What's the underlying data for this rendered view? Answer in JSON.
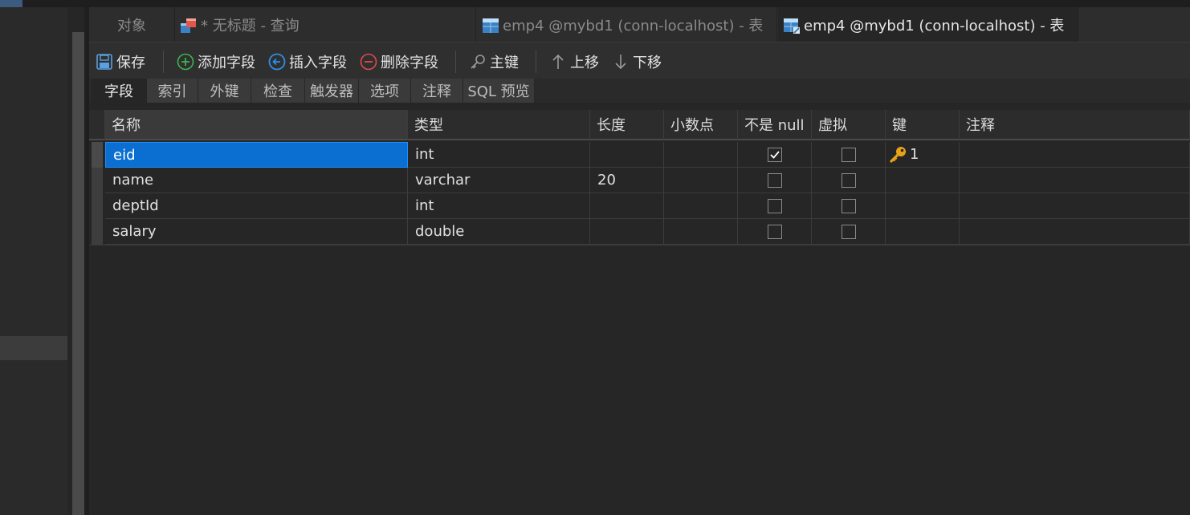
{
  "tabs": [
    {
      "label": "对象",
      "active": false
    },
    {
      "label": "* 无标题 - 查询",
      "active": false,
      "icon": "query-icon"
    },
    {
      "label": "emp4 @mybd1 (conn-localhost) - 表",
      "active": false,
      "icon": "table-icon"
    },
    {
      "label": "emp4 @mybd1 (conn-localhost) - 表",
      "active": true,
      "icon": "table-design-icon"
    }
  ],
  "toolbar": {
    "save": "保存",
    "add_field": "添加字段",
    "insert_field": "插入字段",
    "delete_field": "删除字段",
    "primary_key": "主键",
    "move_up": "上移",
    "move_down": "下移"
  },
  "subtabs": [
    "字段",
    "索引",
    "外键",
    "检查",
    "触发器",
    "选项",
    "注释",
    "SQL 预览"
  ],
  "columns": [
    "名称",
    "类型",
    "长度",
    "小数点",
    "不是 null",
    "虚拟",
    "键",
    "注释"
  ],
  "rows": [
    {
      "name": "eid",
      "type": "int",
      "length": "",
      "decimals": "",
      "not_null": true,
      "virtual": false,
      "key": "1",
      "comment": ""
    },
    {
      "name": "name",
      "type": "varchar",
      "length": "20",
      "decimals": "",
      "not_null": false,
      "virtual": false,
      "key": "",
      "comment": ""
    },
    {
      "name": "deptId",
      "type": "int",
      "length": "",
      "decimals": "",
      "not_null": false,
      "virtual": false,
      "key": "",
      "comment": ""
    },
    {
      "name": "salary",
      "type": "double",
      "length": "",
      "decimals": "",
      "not_null": false,
      "virtual": false,
      "key": "",
      "comment": ""
    }
  ],
  "colors": {
    "selection": "#0a6fd0",
    "key_icon": "#e8a317",
    "add_icon": "#3fb34f",
    "insert_icon": "#2f8fe8",
    "delete_icon": "#e04a4a"
  }
}
